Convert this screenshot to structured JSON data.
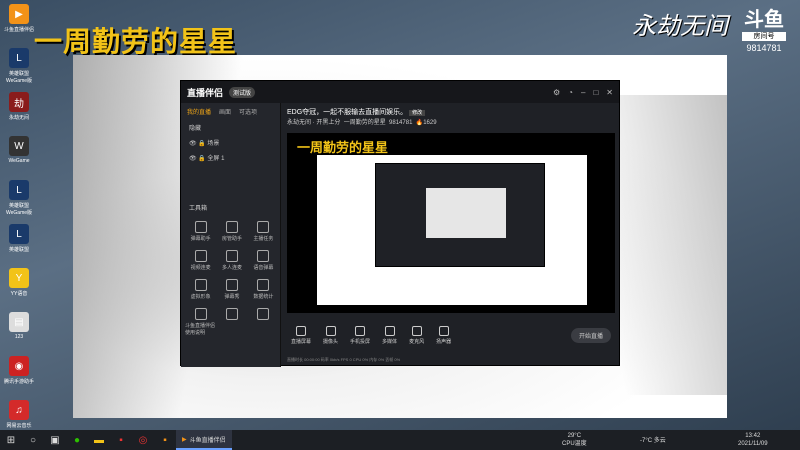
{
  "banner": {
    "title": "一周勤劳的星星",
    "logo": "永劫无间"
  },
  "room": {
    "platform": "斗鱼",
    "label": "房间号",
    "number": "9814781"
  },
  "desktop_icons": [
    {
      "label": "斗鱼直播伴侣",
      "color": "#f29218",
      "glyph": "▶"
    },
    {
      "label": "英雄联盟 WeGame版",
      "color": "#1a3a6a",
      "glyph": "L"
    },
    {
      "label": "永劫无间",
      "color": "#8a1c1c",
      "glyph": "劫"
    },
    {
      "label": "WeGame",
      "color": "#333333",
      "glyph": "W"
    },
    {
      "label": "英雄联盟 WeGame版",
      "color": "#1a3a6a",
      "glyph": "L"
    },
    {
      "label": "英雄联盟",
      "color": "#1a3a6a",
      "glyph": "L"
    },
    {
      "label": "YY语音",
      "color": "#f2c318",
      "glyph": "Y"
    },
    {
      "label": "123",
      "color": "#dddddd",
      "glyph": "▤"
    },
    {
      "label": "腾讯手游助手",
      "color": "#cc2222",
      "glyph": "◉"
    },
    {
      "label": "网易云音乐",
      "color": "#d42a2a",
      "glyph": "♫"
    }
  ],
  "app": {
    "logo": "直播伴侣",
    "version": "测试版",
    "tabs": [
      "我的直播",
      "画面",
      "可选项"
    ],
    "scenes": [
      "场景",
      "全屏 1"
    ],
    "scene_toggle": "隐藏",
    "tools_header": "工具箱",
    "tools": [
      "弹幕助手",
      "房管助手",
      "主播任务",
      "视频连麦",
      "多人连麦",
      "语音弹幕",
      "虚拟形象",
      "弹幕秀",
      "数据统计",
      "斗鱼直播伴侣使用说明",
      "",
      ""
    ],
    "stream_title": "EDG夺冠，一起不服输去直播间娱乐。",
    "stream_tag": "修改",
    "stream_category": "永劫无间 · 开黑上分",
    "stream_author": "一周勤劳的星星",
    "stream_room": "9814781",
    "stream_fans": "1629",
    "preview_title": "一周勤劳的星星",
    "bottom_items": [
      "直播屏幕",
      "摄像头",
      "手机投屏",
      "多媒体",
      "麦克风",
      "扬声器"
    ],
    "start_label": "开始直播",
    "status_text": "直播时长 00:00:00   码率 0kb/s   FPS 0   CPU 0%   内存 0%   丢帧 0%"
  },
  "taskbar": {
    "app_label": "斗鱼直播伴侣",
    "weather_temp": "29°C",
    "weather_desc": "CPU温度",
    "tray": "-7°C  多云",
    "time": "13:42",
    "date": "2021/11/09"
  }
}
